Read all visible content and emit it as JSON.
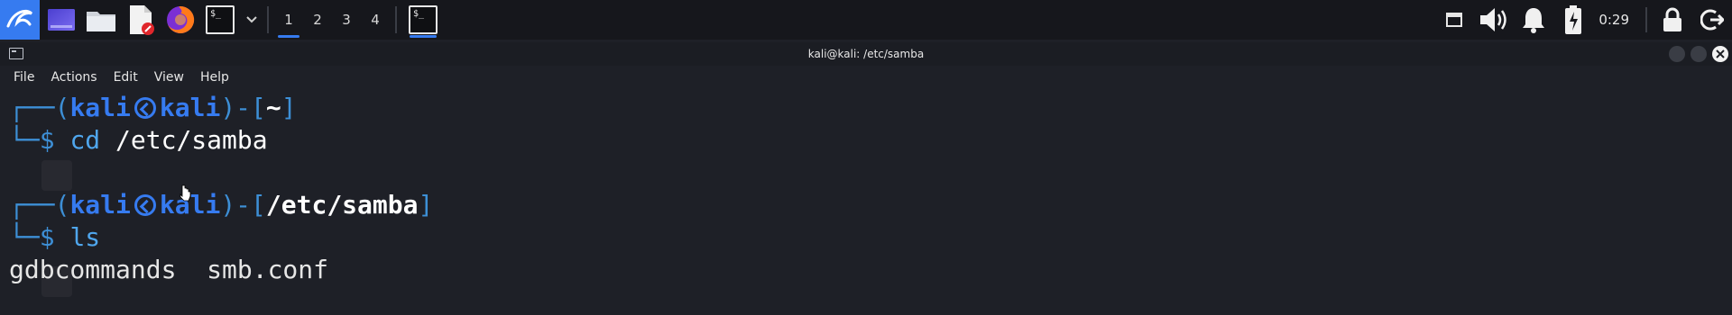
{
  "panel": {
    "workspaces": [
      "1",
      "2",
      "3",
      "4"
    ],
    "terminal_glyph": "$_",
    "clock": "0:29",
    "icons": [
      "kali-menu-icon",
      "desktop-icon",
      "file-manager-icon",
      "text-editor-icon",
      "firefox-icon",
      "terminal-icon",
      "dropdown-chevron-icon",
      "window-icon",
      "volume-icon",
      "notification-bell-icon",
      "battery-icon",
      "lock-icon",
      "logout-icon"
    ]
  },
  "window": {
    "title": "kali@kali: /etc/samba"
  },
  "menu": {
    "file": "File",
    "actions": "Actions",
    "edit": "Edit",
    "view": "View",
    "help": "Help"
  },
  "terminal": {
    "block1": {
      "frame_open": "┌──(",
      "user": "kali",
      "host": "kali",
      "frame_mid": ")-[",
      "path": "~",
      "frame_close": "]",
      "prompt": "└─$ ",
      "cmd": "cd",
      "arg": "/etc/samba"
    },
    "block2": {
      "frame_open": "┌──(",
      "user": "kali",
      "host": "kali",
      "frame_mid": ")-[",
      "path": "/etc/samba",
      "frame_close": "]",
      "prompt": "└─$ ",
      "cmd": "ls"
    },
    "output": "gdbcommands  smb.conf"
  },
  "colors": {
    "accent": "#367bf0",
    "panel_bg": "#16171c",
    "terminal_bg": "#1e2027"
  }
}
